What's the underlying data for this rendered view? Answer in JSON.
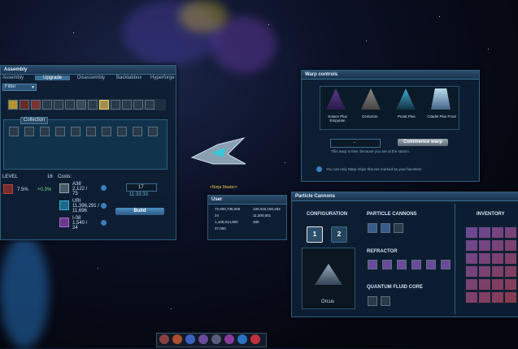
{
  "assembly": {
    "title": "Assembly",
    "tabs": [
      "Assembly",
      "Upgrade",
      "Disassembly",
      "Backtabbox",
      "Hyperforge"
    ],
    "filter_label": "Filter",
    "collection_label": "Collection",
    "level_label": "LEVEL",
    "level_value": "16",
    "costs_label": "Costs:",
    "progress_text": "7.5%",
    "progress_bonus": "+0.3%",
    "costs": [
      {
        "name": "A38",
        "amount": "2,122 /",
        "sub": "73"
      },
      {
        "name": "URI",
        "amount": "11,396,291 /",
        "sub": "11,696"
      },
      {
        "name": "I-08",
        "amount": "1,540 /",
        "sub": "24"
      }
    ],
    "quantity": "17",
    "timer": "11:33:33",
    "build_label": "Build"
  },
  "warp": {
    "title": "Warp controls",
    "ships": [
      "Solace Plus Empyrian",
      "Centurion",
      "Pusat Plus",
      "Citadel Plus Frost"
    ],
    "input_value": "-",
    "commence_label": "Commence warp",
    "free_note": "This warp is free, because you are at the station.",
    "info_note": "You can only Warp ships that are marked as your favorites!"
  },
  "player": {
    "name": "<Ninja Master>"
  },
  "user": {
    "title": "User",
    "stats": [
      "72,000,738,005",
      "100,040,160,402",
      "24",
      "11,300,001",
      "1,100,014,900",
      "480",
      "27,000"
    ]
  },
  "particle": {
    "title": "Particle Cannons",
    "config_label": "CONFIGURATION",
    "config_options": [
      "1",
      "2"
    ],
    "ship_name": "Orcus",
    "cannons_label": "PARTICLE CANNONS",
    "refractor_label": "REFRACTOR",
    "quantum_label": "QUANTUM FLUID CORE",
    "inventory_label": "INVENTORY"
  }
}
